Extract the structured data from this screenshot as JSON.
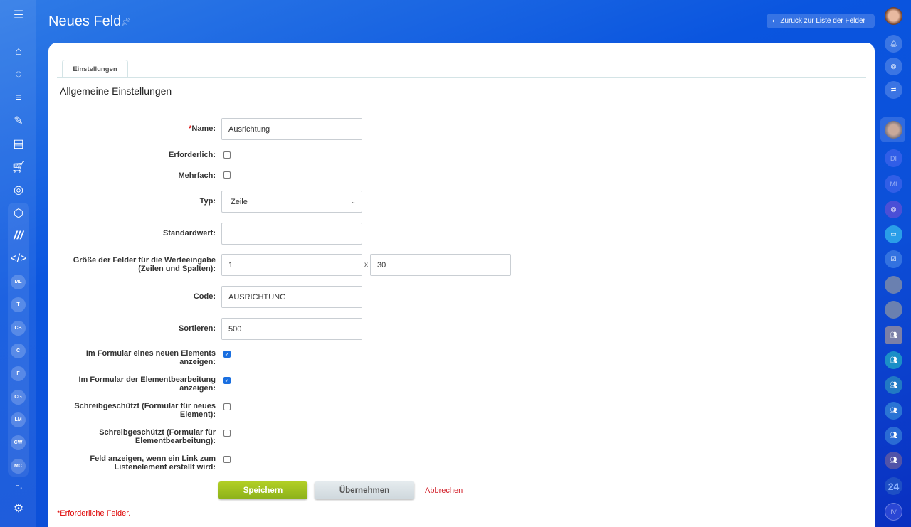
{
  "header": {
    "title": "Neues Feld",
    "back_label": "Zurück zur Liste der Felder"
  },
  "left_sidebar": {
    "icons": [
      "menu-icon",
      "home-icon",
      "crm-icon",
      "funnel-icon",
      "sign-icon",
      "contact-card-icon",
      "cart-icon",
      "target-icon",
      "box-icon",
      "automation-icon",
      "code-icon"
    ],
    "avatars": [
      "ML",
      "T",
      "CB",
      "C",
      "F",
      "CG",
      "LM",
      "CW",
      "MC"
    ]
  },
  "right_sidebar": {
    "items": [
      "DI",
      "MI"
    ],
    "logo": "24",
    "last": "IV"
  },
  "tabs": [
    {
      "label": "Einstellungen"
    }
  ],
  "section_title": "Allgemeine Einstellungen",
  "form": {
    "name": {
      "label": "Name:",
      "required_mark": "*",
      "value": "Ausrichtung"
    },
    "required": {
      "label": "Erforderlich:",
      "checked": false
    },
    "multiple": {
      "label": "Mehrfach:",
      "checked": false
    },
    "type": {
      "label": "Typ:",
      "value": "Zeile"
    },
    "default": {
      "label": "Standardwert:",
      "value": ""
    },
    "size": {
      "label1": "Größe der Felder für die Werteeingabe",
      "label2": "(Zeilen und Spalten):",
      "rows": "1",
      "separator": "x",
      "cols": "30"
    },
    "code": {
      "label": "Code:",
      "value": "AUSRICHTUNG"
    },
    "sort": {
      "label": "Sortieren:",
      "value": "500"
    },
    "show_new": {
      "label1": "Im Formular eines neuen Elements",
      "label2": "anzeigen:",
      "checked": true
    },
    "show_edit": {
      "label1": "Im Formular der Elementbearbeitung",
      "label2": "anzeigen:",
      "checked": true
    },
    "ro_new": {
      "label1": "Schreibgeschützt (Formular für neues",
      "label2": "Element):",
      "checked": false
    },
    "ro_edit": {
      "label1": "Schreibgeschützt (Formular für",
      "label2": "Elementbearbeitung):",
      "checked": false
    },
    "show_link": {
      "label1": "Feld anzeigen, wenn ein Link zum",
      "label2": "Listenelement erstellt wird:",
      "checked": false
    }
  },
  "buttons": {
    "save": "Speichern",
    "apply": "Übernehmen",
    "cancel": "Abbrechen"
  },
  "footnote": {
    "mark": "*",
    "text": "Erforderliche Felder."
  }
}
